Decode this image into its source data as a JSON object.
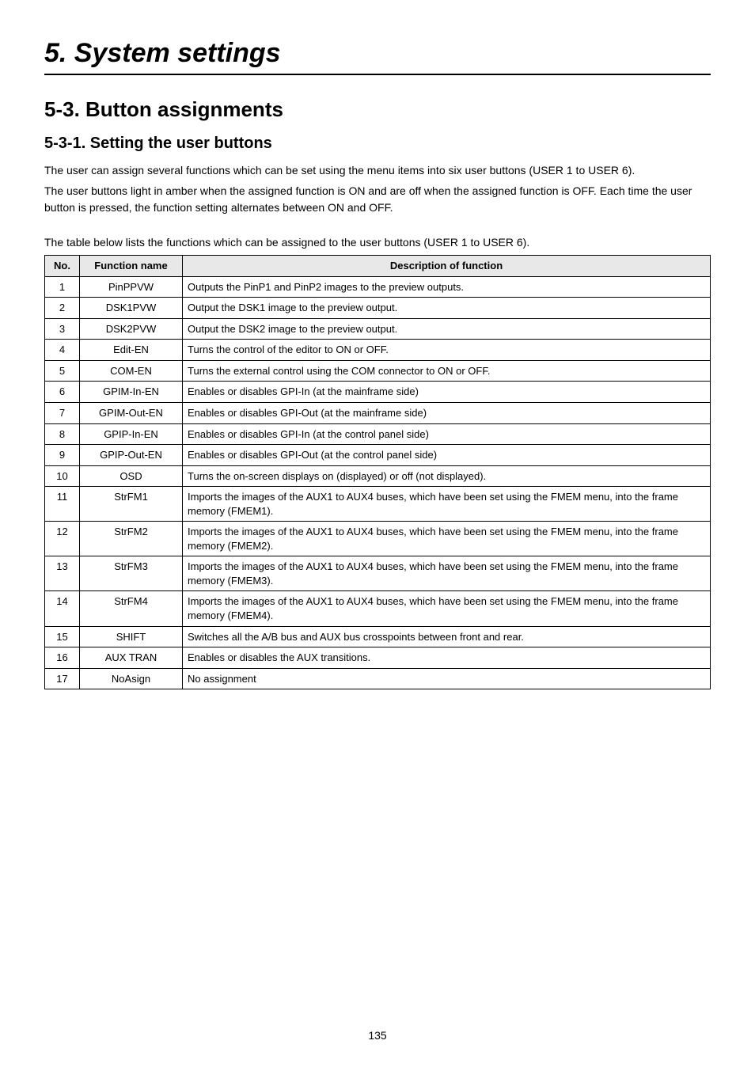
{
  "page": {
    "h1": "5. System settings",
    "h2": "5-3. Button assignments",
    "h3": "5-3-1. Setting the user buttons",
    "p1": "The user can assign several functions which can be set using the menu items into six user buttons (USER 1 to USER 6).",
    "p2": "The user buttons light in amber when the assigned function is ON and are off when the assigned function is OFF. Each time the user button is pressed, the function setting alternates between ON and OFF.",
    "p3": "The table below lists the functions which can be assigned to the user buttons (USER 1 to USER 6).",
    "number": "135"
  },
  "table": {
    "head": {
      "no": "No.",
      "fn": "Function name",
      "desc": "Description of function"
    },
    "rows": [
      {
        "no": "1",
        "fn": "PinPPVW",
        "desc": "Outputs the PinP1 and PinP2 images to the preview outputs."
      },
      {
        "no": "2",
        "fn": "DSK1PVW",
        "desc": "Output the DSK1 image to the preview output."
      },
      {
        "no": "3",
        "fn": "DSK2PVW",
        "desc": "Output the DSK2 image to the preview output."
      },
      {
        "no": "4",
        "fn": "Edit-EN",
        "desc": "Turns the control of the editor to ON or OFF."
      },
      {
        "no": "5",
        "fn": "COM-EN",
        "desc": "Turns the external control using the COM connector to ON or OFF."
      },
      {
        "no": "6",
        "fn": "GPIM-In-EN",
        "desc": "Enables or disables GPI-In (at the mainframe side)"
      },
      {
        "no": "7",
        "fn": "GPIM-Out-EN",
        "desc": "Enables or disables GPI-Out (at the mainframe side)"
      },
      {
        "no": "8",
        "fn": "GPIP-In-EN",
        "desc": "Enables or disables GPI-In (at the control panel side)"
      },
      {
        "no": "9",
        "fn": "GPIP-Out-EN",
        "desc": "Enables or disables GPI-Out (at the control panel side)"
      },
      {
        "no": "10",
        "fn": "OSD",
        "desc": "Turns the on-screen displays on (displayed) or off (not displayed)."
      },
      {
        "no": "11",
        "fn": "StrFM1",
        "desc": "Imports the images of the AUX1 to AUX4 buses, which have been set using the FMEM menu, into the frame memory (FMEM1)."
      },
      {
        "no": "12",
        "fn": "StrFM2",
        "desc": "Imports the images of the AUX1 to AUX4 buses, which have been set using the FMEM menu, into the frame memory (FMEM2)."
      },
      {
        "no": "13",
        "fn": "StrFM3",
        "desc": "Imports the images of the AUX1 to AUX4 buses, which have been set using the FMEM menu, into the frame memory (FMEM3)."
      },
      {
        "no": "14",
        "fn": "StrFM4",
        "desc": "Imports the images of the AUX1 to AUX4 buses, which have been set using the FMEM menu, into the frame memory (FMEM4)."
      },
      {
        "no": "15",
        "fn": "SHIFT",
        "desc": "Switches all the A/B bus and AUX bus crosspoints between front and rear."
      },
      {
        "no": "16",
        "fn": "AUX TRAN",
        "desc": "Enables or disables the AUX transitions."
      },
      {
        "no": "17",
        "fn": "NoAsign",
        "desc": "No assignment"
      }
    ]
  }
}
